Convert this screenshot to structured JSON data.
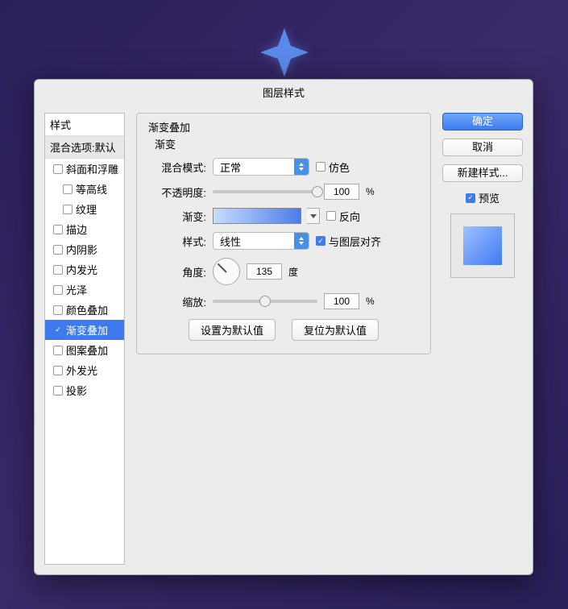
{
  "dialog": {
    "title": "图层样式"
  },
  "left": {
    "header": "样式",
    "blend": "混合选项:默认",
    "items": [
      {
        "label": "斜面和浮雕",
        "checked": false,
        "indent": 1
      },
      {
        "label": "等高线",
        "checked": false,
        "indent": 2
      },
      {
        "label": "纹理",
        "checked": false,
        "indent": 2
      },
      {
        "label": "描边",
        "checked": false,
        "indent": 1
      },
      {
        "label": "内阴影",
        "checked": false,
        "indent": 1
      },
      {
        "label": "内发光",
        "checked": false,
        "indent": 1
      },
      {
        "label": "光泽",
        "checked": false,
        "indent": 1
      },
      {
        "label": "颜色叠加",
        "checked": false,
        "indent": 1
      },
      {
        "label": "渐变叠加",
        "checked": true,
        "indent": 1,
        "selected": true
      },
      {
        "label": "图案叠加",
        "checked": false,
        "indent": 1
      },
      {
        "label": "外发光",
        "checked": false,
        "indent": 1
      },
      {
        "label": "投影",
        "checked": false,
        "indent": 1
      }
    ]
  },
  "center": {
    "group_title": "渐变叠加",
    "inner_title": "渐变",
    "blend_mode_label": "混合模式:",
    "blend_mode_value": "正常",
    "dither_label": "仿色",
    "opacity_label": "不透明度:",
    "opacity_value": "100",
    "opacity_unit": "%",
    "gradient_label": "渐变:",
    "reverse_label": "反向",
    "style_label": "样式:",
    "style_value": "线性",
    "align_label": "与图层对齐",
    "angle_label": "角度:",
    "angle_value": "135",
    "angle_unit": "度",
    "scale_label": "缩放:",
    "scale_value": "100",
    "scale_unit": "%",
    "btn_default": "设置为默认值",
    "btn_reset": "复位为默认值"
  },
  "right": {
    "ok": "确定",
    "cancel": "取消",
    "newstyle": "新建样式...",
    "preview": "预览",
    "preview_checked": true
  }
}
